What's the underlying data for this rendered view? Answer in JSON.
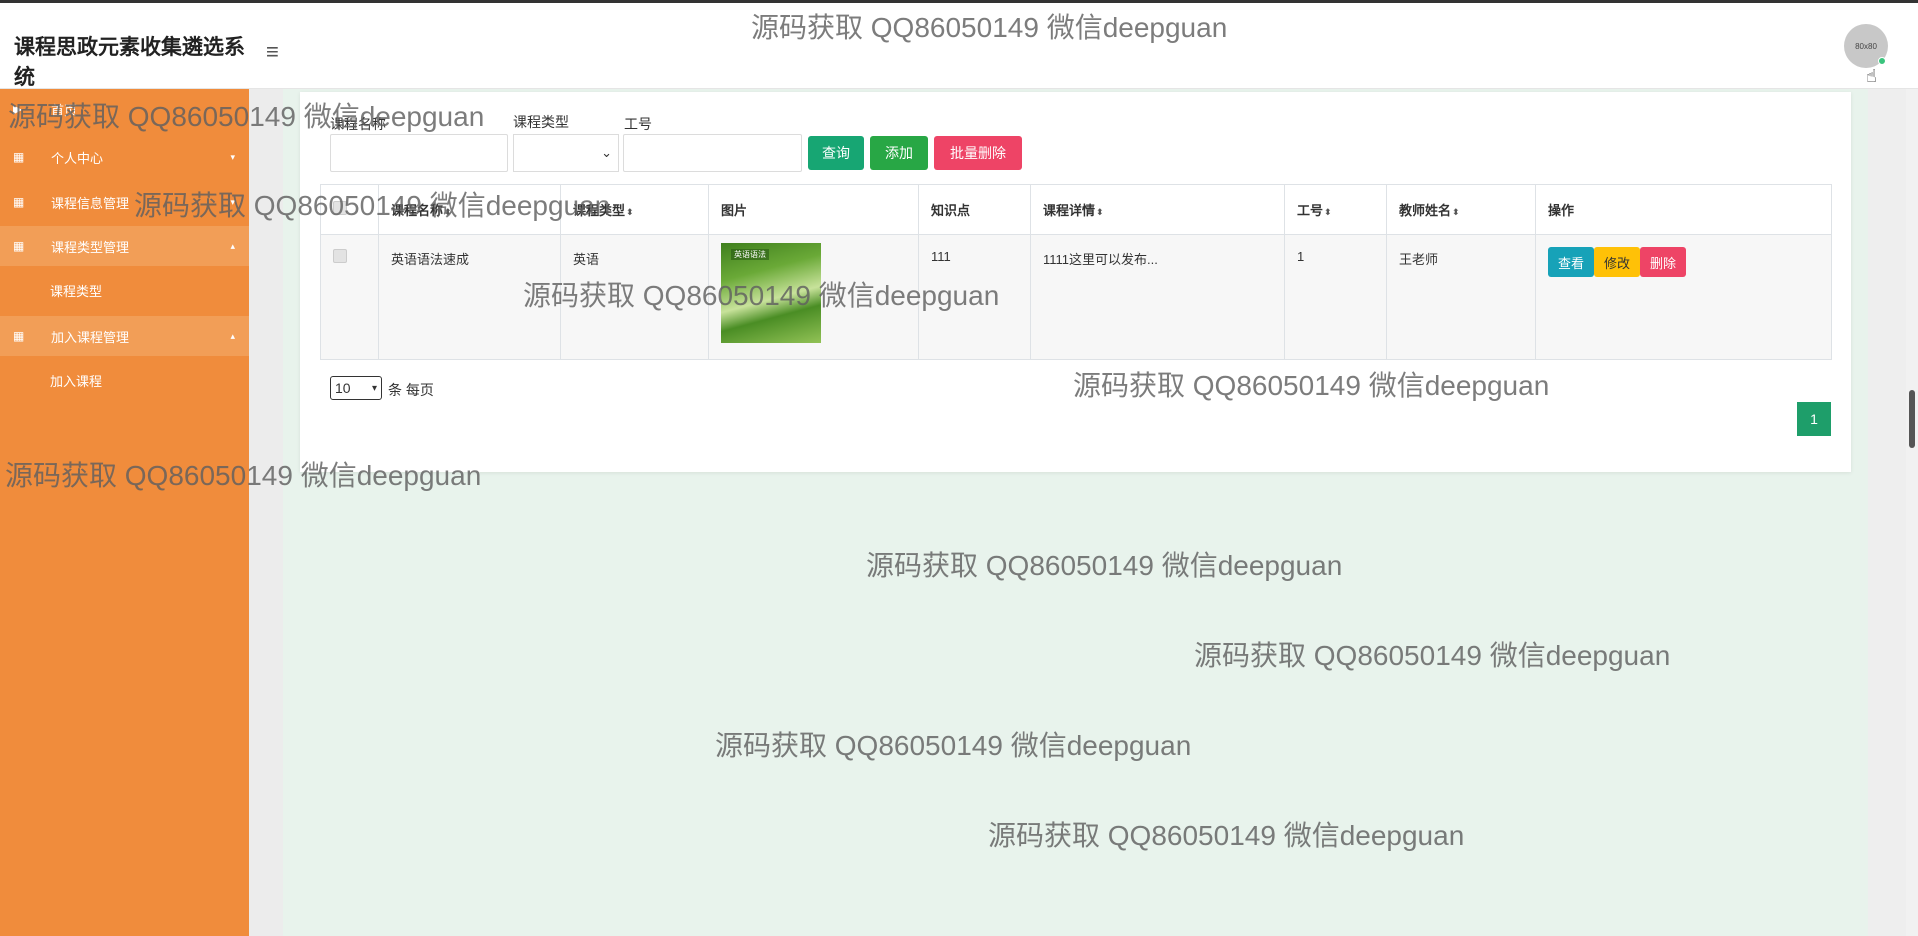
{
  "app": {
    "title": "课程思政元素收集遴选系统",
    "avatar_text": "80x80"
  },
  "sidebar": {
    "home": "首页",
    "items": [
      {
        "label": "个人中心",
        "expanded": false
      },
      {
        "label": "课程信息管理",
        "expanded": false
      },
      {
        "label": "课程类型管理",
        "expanded": true,
        "children": [
          "课程类型"
        ]
      },
      {
        "label": "加入课程管理",
        "expanded": true,
        "children": [
          "加入课程"
        ]
      }
    ]
  },
  "search": {
    "course_name_label": "课程名称",
    "course_name_value": "",
    "course_type_label": "课程类型",
    "course_type_value": "",
    "work_no_label": "工号",
    "work_no_value": "",
    "query_button": "查询",
    "add_button": "添加",
    "batch_delete_button": "批量删除"
  },
  "table": {
    "columns": [
      "课程名称",
      "课程类型",
      "图片",
      "知识点",
      "课程详情",
      "工号",
      "教师姓名",
      "操作"
    ],
    "rows": [
      {
        "course_name": "英语语法速成",
        "course_type": "英语",
        "image_caption": "英语语法",
        "knowledge": "111",
        "details": "1111这里可以发布...",
        "work_no": "1",
        "teacher": "王老师",
        "actions": {
          "view": "查看",
          "edit": "修改",
          "delete": "删除"
        }
      }
    ]
  },
  "pager": {
    "page_size": "10",
    "page_size_label": "条 每页",
    "current_page": "1"
  },
  "watermark": "源码获取 QQ86050149 微信deepguan",
  "colors": {
    "sidebar": "#f08c3c",
    "query": "#17a673",
    "add": "#28a745",
    "danger": "#ee4466",
    "view": "#17a2b8",
    "edit": "#ffc107",
    "page": "#1e9e6a"
  }
}
